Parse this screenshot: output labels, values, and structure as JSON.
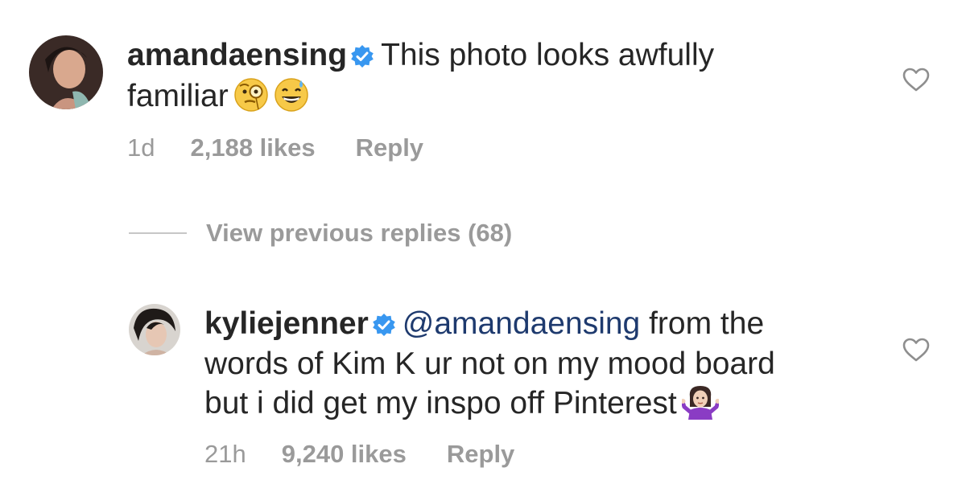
{
  "comments": [
    {
      "username": "amandaensing",
      "text_line1": "This photo looks awfully",
      "text_line2": "familiar",
      "emojis": [
        "face-with-monocle",
        "grinning-face-with-sweat"
      ],
      "time": "1d",
      "likes": "2,188 likes",
      "reply_label": "Reply",
      "verified_icon": "verified-badge-icon",
      "like_icon": "heart-outline-icon"
    },
    {
      "username": "kyliejenner",
      "mention": "@amandaensing",
      "text_line1": "from the",
      "text_line2": "words of Kim K ur not on my mood board",
      "text_line3": "but i did get my inspo off Pinterest",
      "emojis": [
        "woman-shrugging"
      ],
      "time": "21h",
      "likes": "9,240 likes",
      "reply_label": "Reply",
      "verified_icon": "verified-badge-icon",
      "like_icon": "heart-outline-icon"
    }
  ],
  "thread": {
    "view_previous_label": "View previous replies (68)"
  },
  "colors": {
    "text": "#262626",
    "meta": "#9a9a9a",
    "verified": "#3897f0",
    "mention": "#1e3a6e"
  }
}
